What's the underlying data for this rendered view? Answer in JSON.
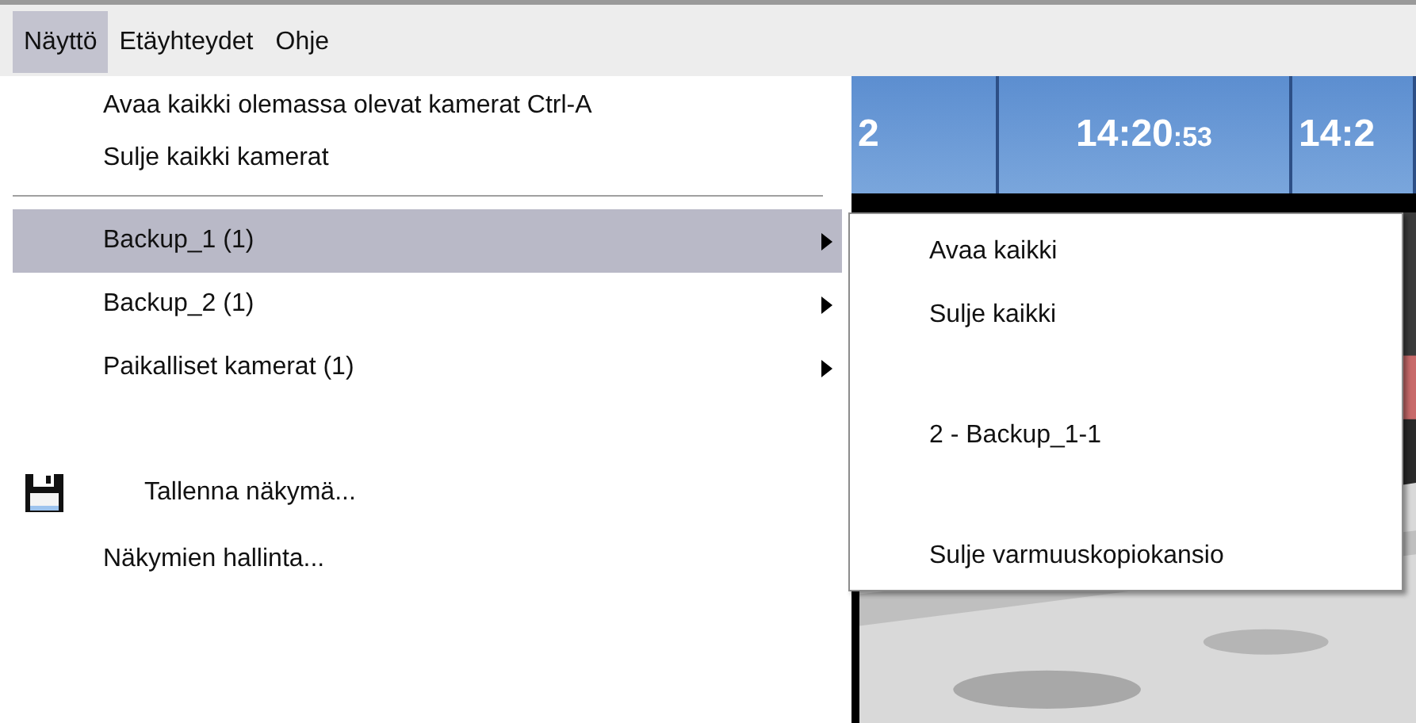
{
  "menu_bar": [
    {
      "label": "Näyttö",
      "selected": true
    },
    {
      "label": "Etäyhteydet",
      "selected": false
    },
    {
      "label": "Ohje",
      "selected": false
    }
  ],
  "view_menu": {
    "sections": [
      {
        "items": [
          {
            "kind": "command",
            "label": "Avaa kaikki olemassa olevat kamerat Ctrl-A",
            "highlighted": false
          },
          {
            "kind": "command",
            "label": "Sulje kaikki kamerat",
            "highlighted": false
          },
          {
            "kind": "separator"
          }
        ]
      },
      {
        "items": [
          {
            "kind": "submenu",
            "label": "Backup_1 (1)",
            "highlighted": true
          },
          {
            "kind": "submenu",
            "label": "Backup_2 (1)",
            "highlighted": false
          },
          {
            "kind": "submenu",
            "label": "Paikalliset kamerat (1)",
            "highlighted": false
          }
        ]
      },
      {
        "items": [
          {
            "kind": "save",
            "label": "Tallenna näkymä...",
            "highlighted": false
          },
          {
            "kind": "command",
            "label": "Näkymien hallinta...",
            "highlighted": false
          }
        ]
      }
    ]
  },
  "submenu": {
    "sections": [
      [
        "Avaa kaikki",
        "Sulje kaikki"
      ],
      [
        "2 - Backup_1-1"
      ],
      [
        "Sulje varmuuskopiokansio"
      ]
    ]
  },
  "camera_header": [
    {
      "time": "2"
    },
    {
      "time": "14:20",
      "seconds": ":53"
    },
    {
      "time": "14:2"
    }
  ]
}
